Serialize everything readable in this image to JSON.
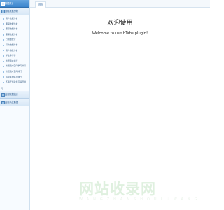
{
  "sidebar": {
    "panel1_title": "数据统计",
    "panel2_title": "运维数据分析",
    "items": [
      {
        "label": "用户数据分析"
      },
      {
        "label": "课程数据分析"
      },
      {
        "label": "课程数据分析"
      },
      {
        "label": "课程数据分析"
      },
      {
        "label": "行用量统计"
      },
      {
        "label": "行为数据分析"
      },
      {
        "label": "用户路径分析"
      },
      {
        "label": "学生排行榜"
      },
      {
        "label": "新增用户排行"
      },
      {
        "label": "新增用户空间学习排行"
      },
      {
        "label": "新增用户空间排行"
      },
      {
        "label": "班级答题情况排行"
      },
      {
        "label": "不满于班级学习情况排"
      }
    ],
    "wrap_tail": "行",
    "panel3_title": "监测数据统计",
    "panel4_title": "监测系统数据"
  },
  "tabs": [
    {
      "label": "首页"
    }
  ],
  "main": {
    "title": "欢迎使用",
    "subtitle": "Welcome to use bTabs plugin!"
  },
  "watermark": {
    "text": "网站收录网",
    "sub": "WANGZHANSHOULUWANG"
  }
}
